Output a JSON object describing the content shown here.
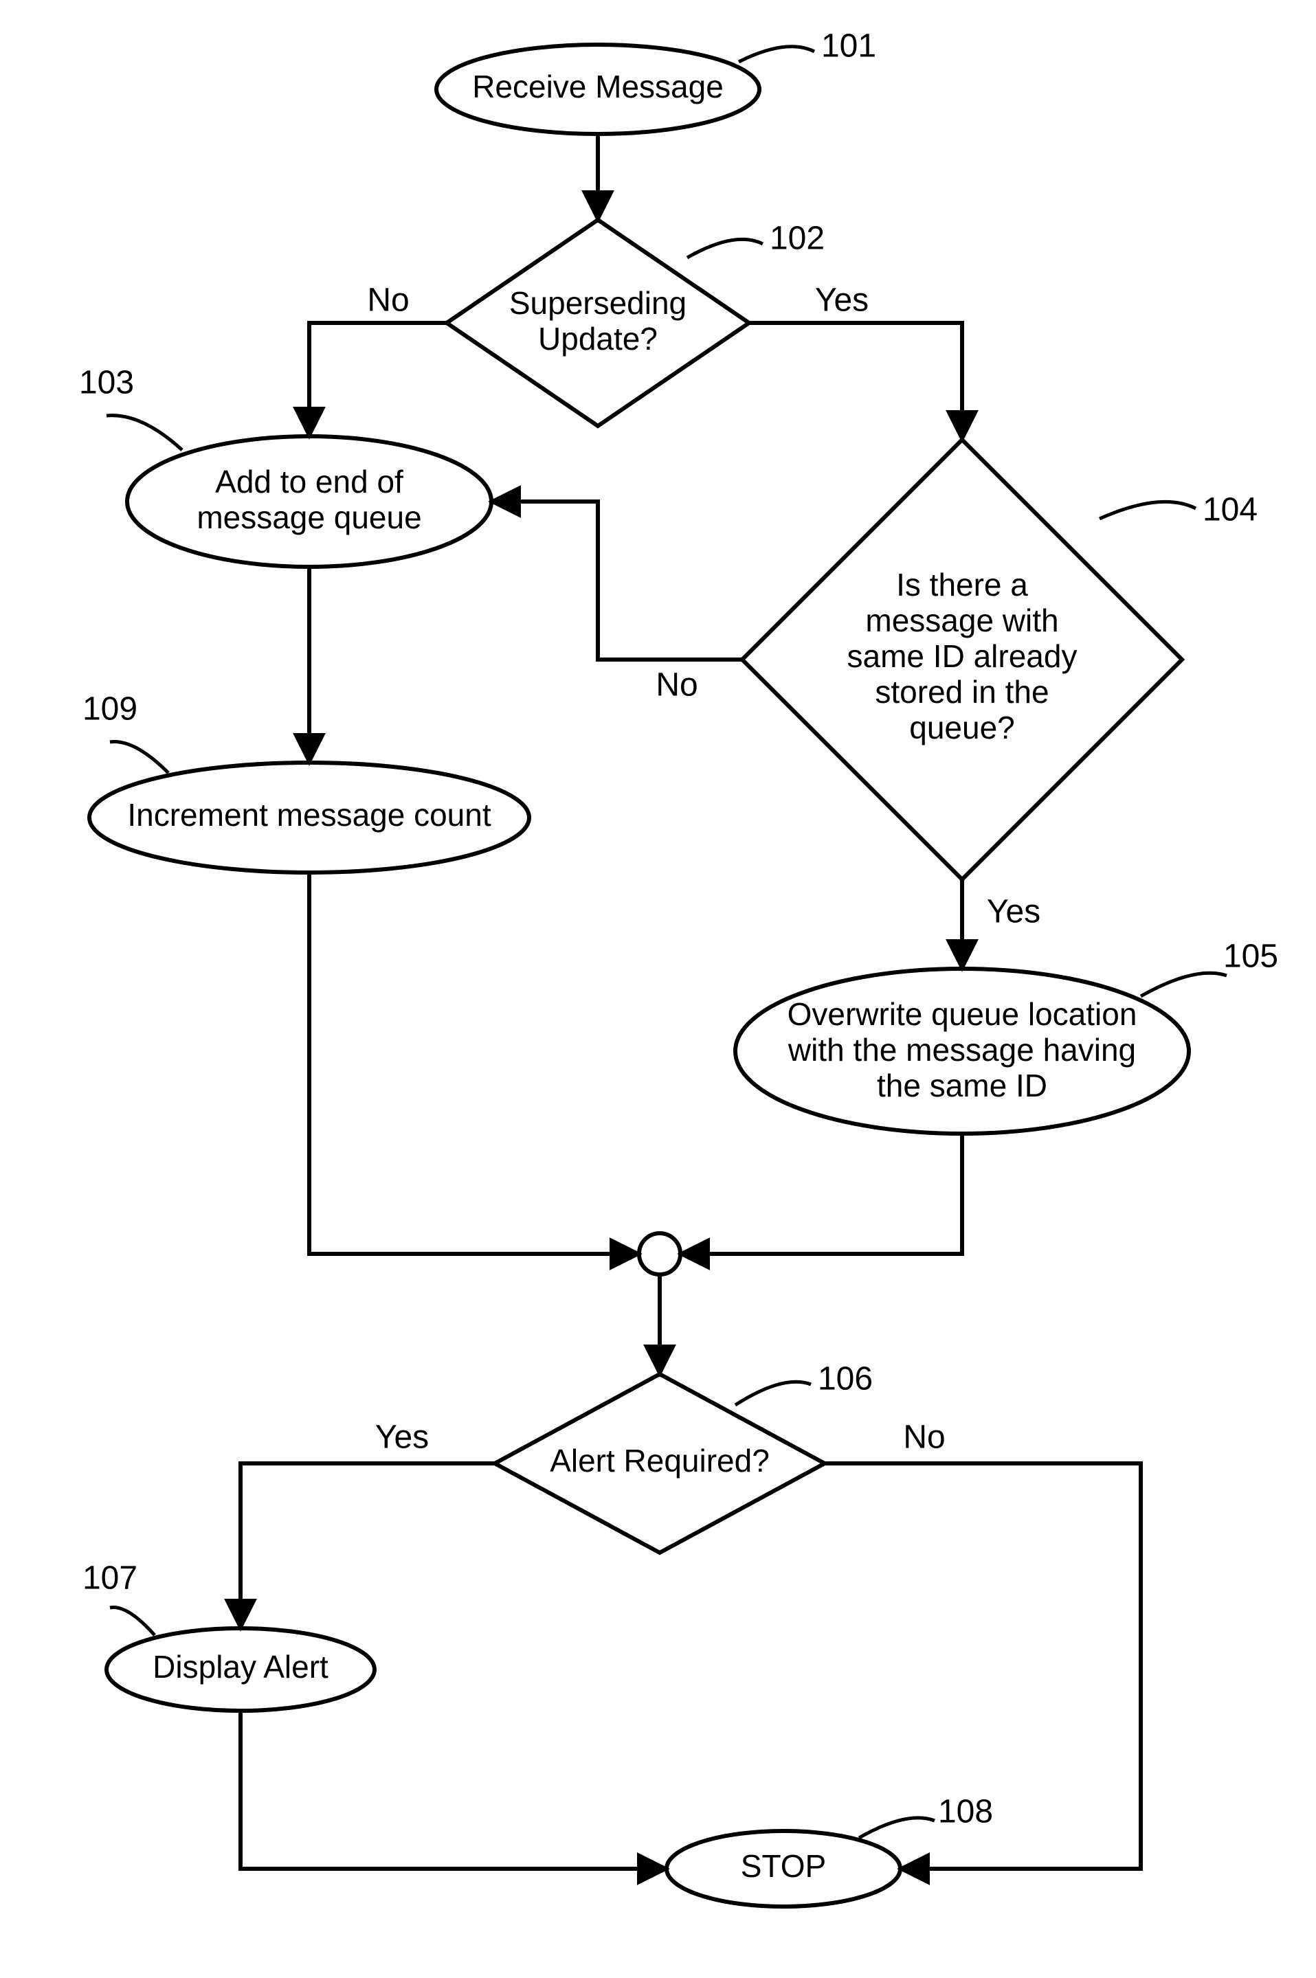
{
  "nodes": {
    "n101": {
      "ref": "101",
      "text": "Receive Message"
    },
    "n102": {
      "ref": "102",
      "text": "Superseding\nUpdate?"
    },
    "n103": {
      "ref": "103",
      "text": "Add to end of\nmessage queue"
    },
    "n104": {
      "ref": "104",
      "text": "Is there a\nmessage with\nsame ID already\nstored in the\nqueue?"
    },
    "n105": {
      "ref": "105",
      "text": "Overwrite queue location\nwith the message having\nthe same ID"
    },
    "n106": {
      "ref": "106",
      "text": "Alert Required?"
    },
    "n107": {
      "ref": "107",
      "text": "Display Alert"
    },
    "n108": {
      "ref": "108",
      "text": "STOP"
    },
    "n109": {
      "ref": "109",
      "text": "Increment message count"
    }
  },
  "edges": {
    "e102_yes": "Yes",
    "e102_no": "No",
    "e104_yes": "Yes",
    "e104_no": "No",
    "e106_yes": "Yes",
    "e106_no": "No"
  }
}
